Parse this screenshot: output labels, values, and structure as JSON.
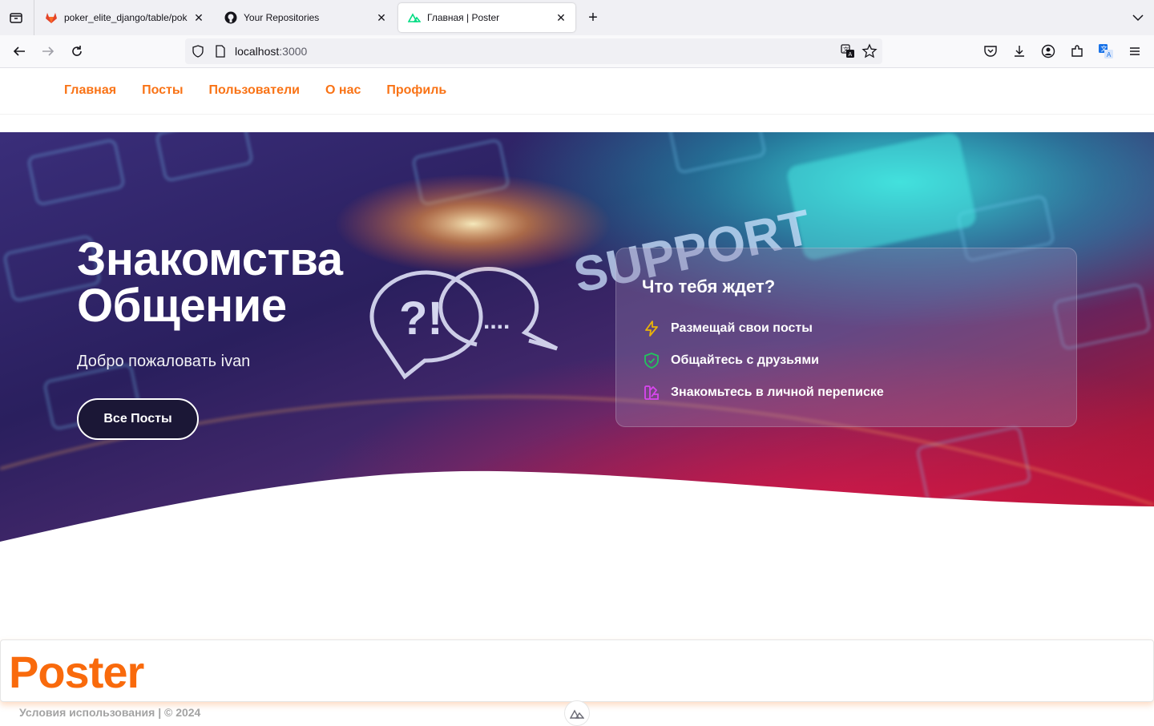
{
  "browser": {
    "tabs": [
      {
        "title": "poker_elite_django/table/poker_",
        "active": false,
        "favicon": "gitlab-icon"
      },
      {
        "title": "Your Repositories",
        "active": false,
        "favicon": "github-icon"
      },
      {
        "title": "Главная | Poster",
        "active": true,
        "favicon": "nuxt-icon"
      }
    ],
    "url_host": "localhost",
    "url_port": ":3000"
  },
  "site": {
    "nav": [
      "Главная",
      "Посты",
      "Пользователи",
      "О нас",
      "Профиль"
    ],
    "accent_color": "#f97316"
  },
  "hero": {
    "title_line1": "Знакомства",
    "title_line2": "Общение",
    "subtitle": "Добро пожаловать ivan",
    "button_label": "Все Посты"
  },
  "features_card": {
    "title": "Что тебя ждет?",
    "items": [
      {
        "label": "Размещай свои посты",
        "icon": "lightning-icon",
        "color": "#eab308"
      },
      {
        "label": "Общайтесь с друзьями",
        "icon": "shield-check-icon",
        "color": "#22c55e"
      },
      {
        "label": "Знакомьтесь в личной переписке",
        "icon": "swatch-icon",
        "color": "#d946ef"
      }
    ]
  },
  "footer": {
    "logo": "Poster",
    "text": "Условия использования | © 2024"
  }
}
